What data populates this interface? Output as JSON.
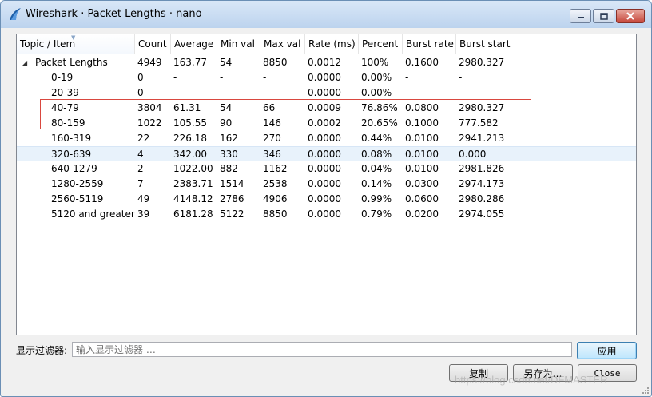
{
  "window": {
    "title": "Wireshark · Packet Lengths · nano",
    "accent": "#1e5fa8"
  },
  "table": {
    "columns": [
      "Topic / Item",
      "Count",
      "Average",
      "Min val",
      "Max val",
      "Rate (ms)",
      "Percent",
      "Burst rate",
      "Burst start"
    ],
    "rows": [
      {
        "item": "Packet Lengths",
        "count": "4949",
        "average": "163.77",
        "min": "54",
        "max": "8850",
        "rate": "0.0012",
        "percent": "100%",
        "burst_rate": "0.1600",
        "burst_start": "2980.327"
      },
      {
        "item": "0-19",
        "count": "0",
        "average": "-",
        "min": "-",
        "max": "-",
        "rate": "0.0000",
        "percent": "0.00%",
        "burst_rate": "-",
        "burst_start": "-"
      },
      {
        "item": "20-39",
        "count": "0",
        "average": "-",
        "min": "-",
        "max": "-",
        "rate": "0.0000",
        "percent": "0.00%",
        "burst_rate": "-",
        "burst_start": "-"
      },
      {
        "item": "40-79",
        "count": "3804",
        "average": "61.31",
        "min": "54",
        "max": "66",
        "rate": "0.0009",
        "percent": "76.86%",
        "burst_rate": "0.0800",
        "burst_start": "2980.327"
      },
      {
        "item": "80-159",
        "count": "1022",
        "average": "105.55",
        "min": "90",
        "max": "146",
        "rate": "0.0002",
        "percent": "20.65%",
        "burst_rate": "0.1000",
        "burst_start": "777.582"
      },
      {
        "item": "160-319",
        "count": "22",
        "average": "226.18",
        "min": "162",
        "max": "270",
        "rate": "0.0000",
        "percent": "0.44%",
        "burst_rate": "0.0100",
        "burst_start": "2941.213"
      },
      {
        "item": "320-639",
        "count": "4",
        "average": "342.00",
        "min": "330",
        "max": "346",
        "rate": "0.0000",
        "percent": "0.08%",
        "burst_rate": "0.0100",
        "burst_start": "0.000"
      },
      {
        "item": "640-1279",
        "count": "2",
        "average": "1022.00",
        "min": "882",
        "max": "1162",
        "rate": "0.0000",
        "percent": "0.04%",
        "burst_rate": "0.0100",
        "burst_start": "2981.826"
      },
      {
        "item": "1280-2559",
        "count": "7",
        "average": "2383.71",
        "min": "1514",
        "max": "2538",
        "rate": "0.0000",
        "percent": "0.14%",
        "burst_rate": "0.0300",
        "burst_start": "2974.173"
      },
      {
        "item": "2560-5119",
        "count": "49",
        "average": "4148.12",
        "min": "2786",
        "max": "4906",
        "rate": "0.0000",
        "percent": "0.99%",
        "burst_rate": "0.0600",
        "burst_start": "2980.286"
      },
      {
        "item": "5120 and greater",
        "count": "39",
        "average": "6181.28",
        "min": "5122",
        "max": "8850",
        "rate": "0.0000",
        "percent": "0.79%",
        "burst_rate": "0.0200",
        "burst_start": "2974.055"
      }
    ],
    "highlight_color": "#d9483f"
  },
  "filter": {
    "label": "显示过滤器:",
    "placeholder": "输入显示过滤器 …",
    "value": "",
    "apply_label": "应用"
  },
  "buttons": {
    "copy_label": "复制",
    "save_as_label": "另存为…",
    "close_label": "Close"
  },
  "watermark": "https://blog.csdn.net/DFMASTER"
}
